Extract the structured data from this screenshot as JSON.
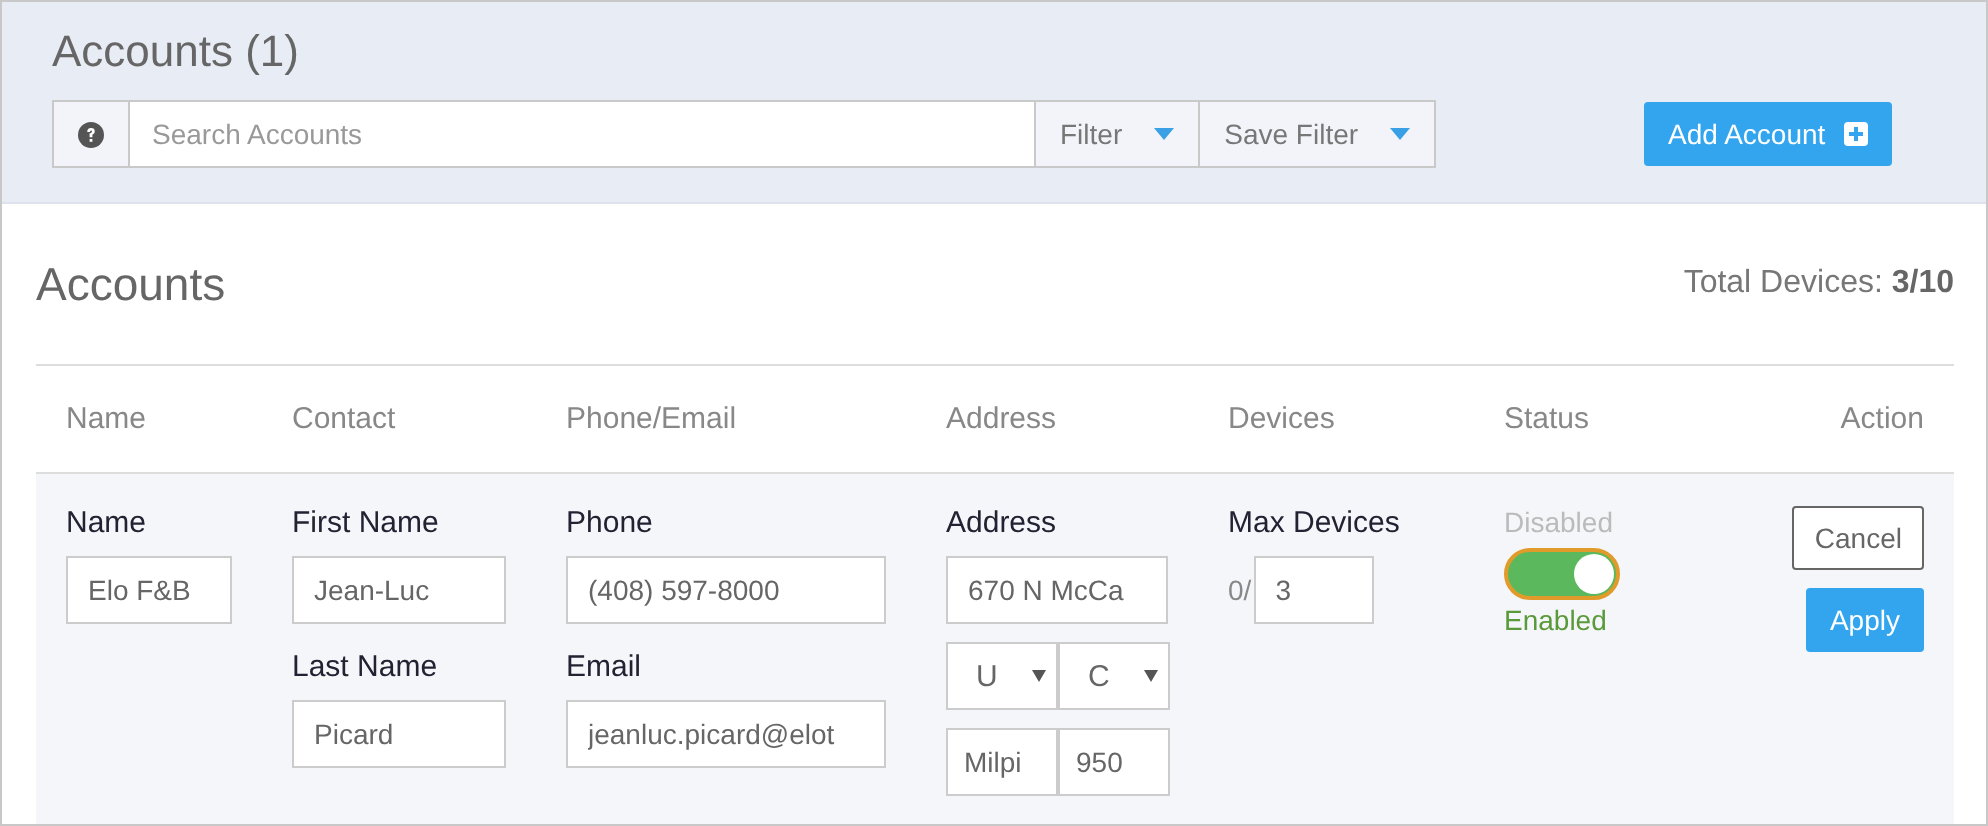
{
  "header": {
    "title": "Accounts (1)",
    "search": {
      "placeholder": "Search Accounts"
    },
    "filter_buttons": [
      "Filter",
      "Save Filter"
    ],
    "add_button": "Add Account"
  },
  "panel": {
    "title": "Accounts",
    "total_label": "Total Devices:",
    "total_value": "3/10"
  },
  "table": {
    "columns": [
      "Name",
      "Contact",
      "Phone/Email",
      "Address",
      "Devices",
      "Status",
      "Action"
    ],
    "edit_row": {
      "name_label": "Name",
      "name": "Elo F&B",
      "first_name_label": "First Name",
      "first_name": "Jean-Luc",
      "last_name_label": "Last Name",
      "last_name": "Picard",
      "phone_label": "Phone",
      "phone": "(408) 597-8000",
      "email_label": "Email",
      "email": "jeanluc.picard@elot",
      "address_label": "Address",
      "street": "670 N McCa",
      "country": "U",
      "state": "C",
      "city": "Milpi",
      "zip": "950",
      "devices_label": "Max Devices",
      "devices_used": "0/",
      "max_devices": "3",
      "status_off_label": "Disabled",
      "status_on_label": "Enabled",
      "status_on": true,
      "cancel": "Cancel",
      "apply": "Apply"
    }
  }
}
